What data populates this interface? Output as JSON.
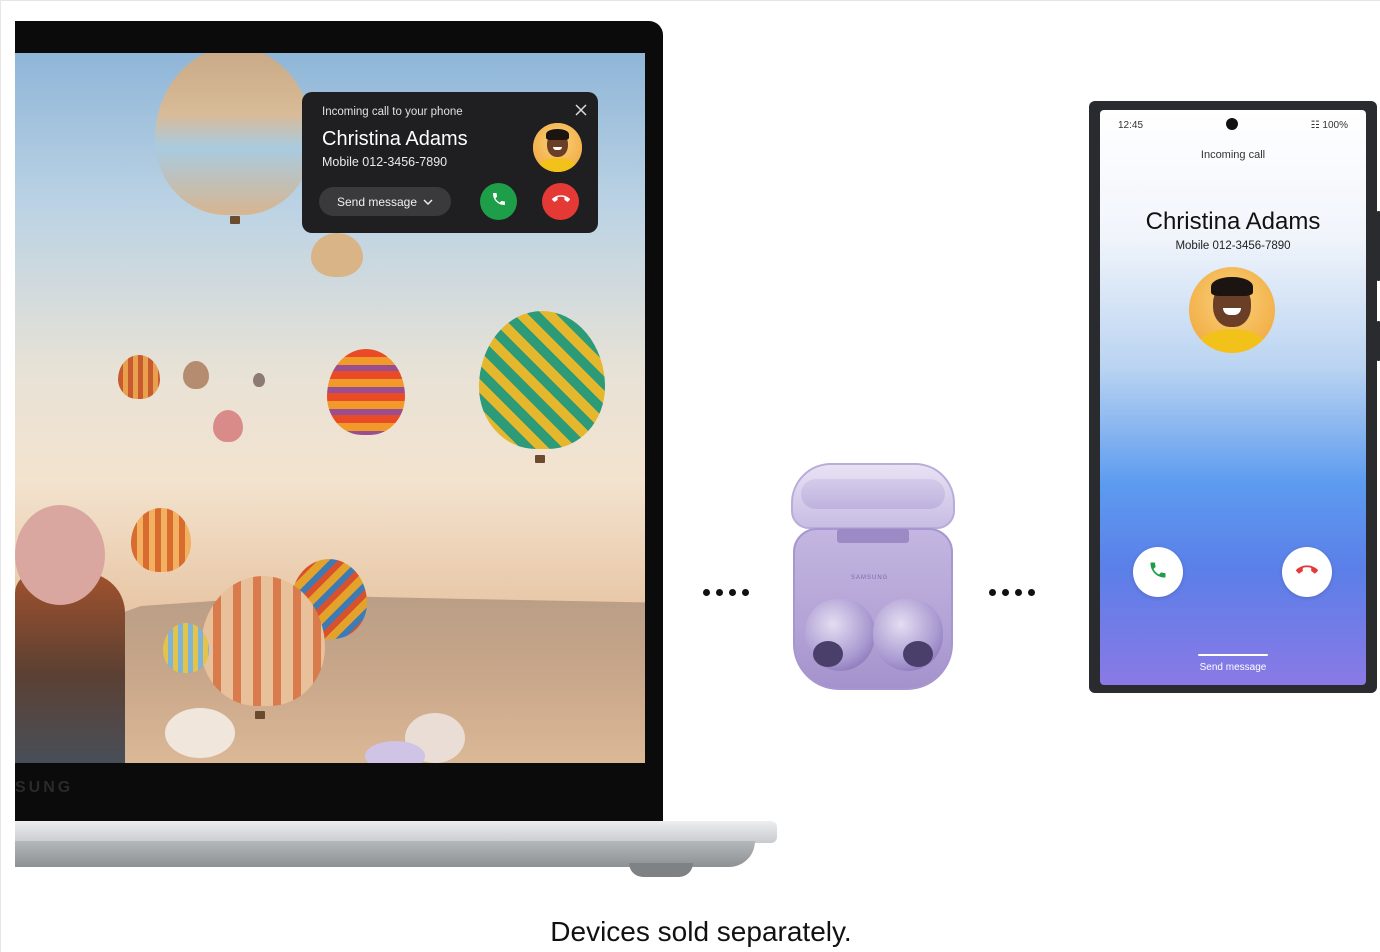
{
  "laptop": {
    "brand": "SUNG",
    "notification": {
      "caption": "Incoming call to your phone",
      "caller_name": "Christina Adams",
      "caller_number": "Mobile  012-3456-7890",
      "send_message_label": "Send message",
      "close_icon": "close-icon",
      "accept_icon": "phone-accept-icon",
      "decline_icon": "phone-decline-icon",
      "accept_color": "#1f9e4a",
      "decline_color": "#e53935"
    }
  },
  "phone": {
    "time": "12:45",
    "status": "100%",
    "caption": "Incoming call",
    "caller_name": "Christina Adams",
    "caller_number": "Mobile  012-3456-7890",
    "send_message_label": "Send message",
    "accept_icon": "phone-accept-icon",
    "decline_icon": "phone-decline-icon"
  },
  "earbuds": {
    "brand": "SAMSUNG"
  },
  "footer": {
    "caption": "Devices sold separately."
  }
}
